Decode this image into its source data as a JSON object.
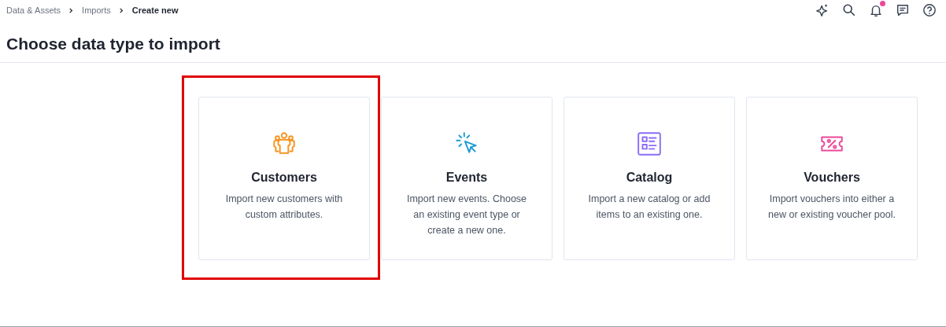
{
  "breadcrumb": [
    {
      "label": "Data & Assets",
      "current": false
    },
    {
      "label": "Imports",
      "current": false
    },
    {
      "label": "Create new",
      "current": true
    }
  ],
  "toolbar": [
    {
      "kind": "sparkle",
      "dot": false
    },
    {
      "kind": "search",
      "dot": false
    },
    {
      "kind": "bell",
      "dot": true
    },
    {
      "kind": "chat",
      "dot": false
    },
    {
      "kind": "help",
      "dot": false
    }
  ],
  "title": "Choose data type to import",
  "cards": [
    {
      "kind": "customers",
      "color": "#f7931e",
      "title": "Customers",
      "description": "Import new customers with custom attributes.",
      "highlighted": true
    },
    {
      "kind": "events",
      "color": "#1a9ad6",
      "title": "Events",
      "description": "Import new events. Choose an existing event type or create a new one.",
      "highlighted": false
    },
    {
      "kind": "catalog",
      "color": "#8b6cf6",
      "title": "Catalog",
      "description": "Import a new catalog or add items to an existing one.",
      "highlighted": false
    },
    {
      "kind": "vouchers",
      "color": "#ec4899",
      "title": "Vouchers",
      "description": "Import vouchers into either a new or existing voucher pool.",
      "highlighted": false
    }
  ]
}
